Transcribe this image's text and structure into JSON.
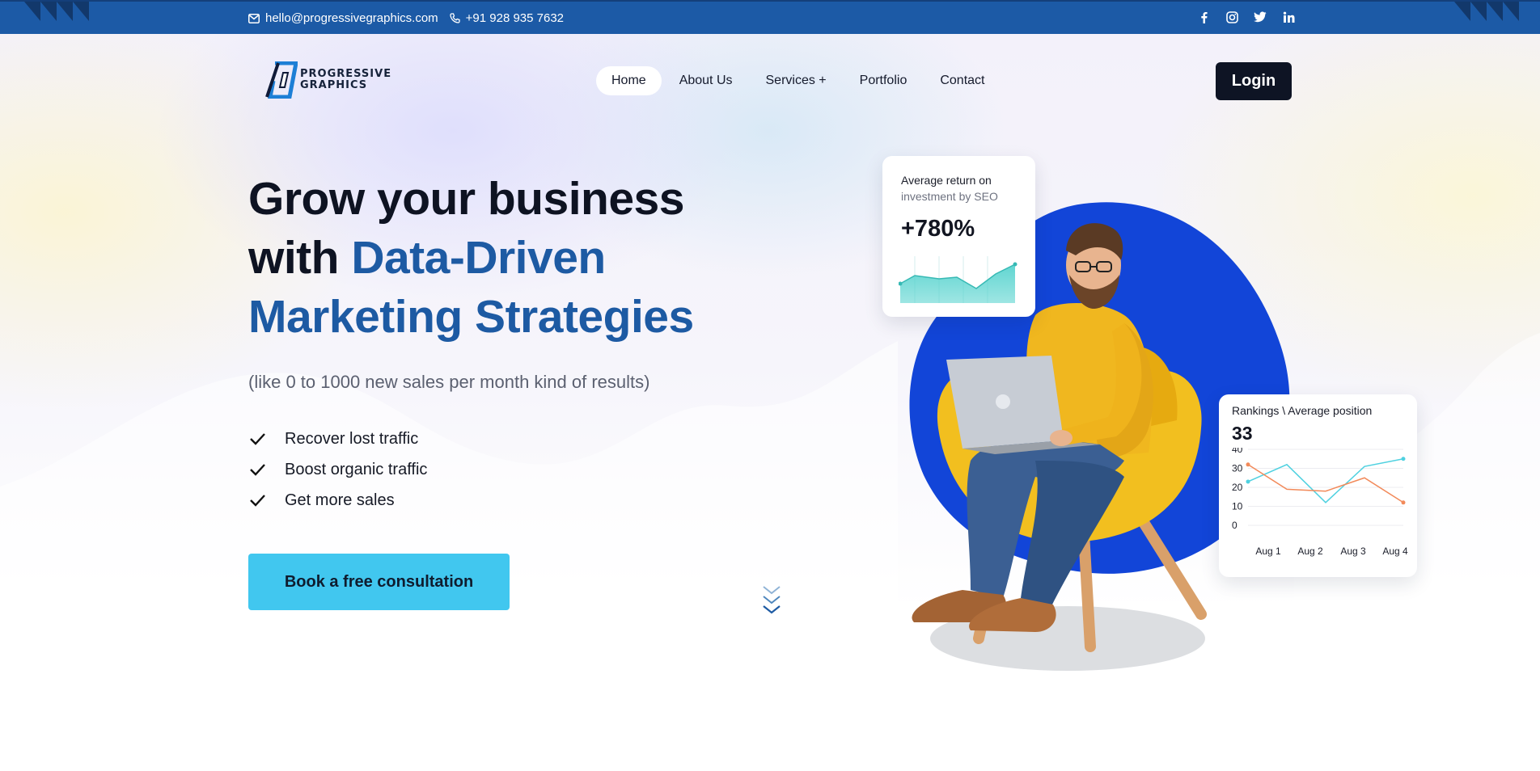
{
  "topbar": {
    "email": "hello@progressivegraphics.com",
    "phone": "+91 928 935 7632",
    "social": [
      "facebook-icon",
      "instagram-icon",
      "twitter-icon",
      "linkedin-icon"
    ],
    "bg_color": "#1c5aa6"
  },
  "header": {
    "logo_line1": "PROGRESSIVE",
    "logo_line2": "GRAPHICS",
    "nav": [
      {
        "label": "Home",
        "active": true
      },
      {
        "label": "About Us"
      },
      {
        "label": "Services +"
      },
      {
        "label": "Portfolio"
      },
      {
        "label": "Contact"
      }
    ],
    "login_label": "Login"
  },
  "hero": {
    "headline_line1": "Grow your business",
    "headline_with": "with ",
    "headline_accent_1": "Data-Driven",
    "headline_accent_2": "Marketing Strategies",
    "subline": "(like 0 to 1000 new sales per month kind of results)",
    "benefits": [
      "Recover lost traffic",
      "Boost organic traffic",
      "Get more sales"
    ],
    "cta_label": "Book a free consultation",
    "accent_color": "#1d5aa3",
    "cta_color": "#41c7ef"
  },
  "roi_card": {
    "line1": "Average return on",
    "line2": "investment by SEO",
    "value": "+780%"
  },
  "rank_card": {
    "title": "Rankings \\ Average position",
    "value": "33"
  },
  "chart_data": {
    "type": "line",
    "categories": [
      "Aug 1",
      "Aug 2",
      "Aug 3",
      "Aug 4"
    ],
    "y_ticks": [
      "40",
      "30",
      "20",
      "10",
      "0"
    ],
    "ylim": [
      0,
      40
    ],
    "series": [
      {
        "color": "#4fd1e0",
        "values": [
          23,
          32,
          12,
          31,
          35
        ]
      },
      {
        "color": "#f28a5a",
        "values": [
          32,
          19,
          18,
          25,
          12
        ]
      }
    ]
  }
}
